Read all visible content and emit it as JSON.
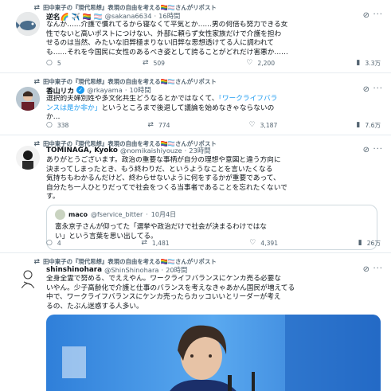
{
  "tweets": [
    {
      "retweeted_by": "田中東子の『現代思想』表現の自由を考える🏳️‍🌈🏳️‍⚧️さんがリポスト",
      "name": "逆名🌈 ✈️ 🏳️‍🌈 🏳️‍⚧️",
      "handle": "@sakana6634",
      "time": "16時間",
      "text": "なんか……介護で慣れてるから寝なくて平気とか……男の何倍も努力できる女\n性でないと高いポストにつけない、外部に頼らず女性家族だけで介護を担わ\nせるのは当然、みたいな旧弊極まりない旧弊な思想透けてる人に調われて\nも……それを今国民に女性のあるべき姿として誇ることがどれだけ害悪か……",
      "replies": "5",
      "retweets": "509",
      "likes": "2,200",
      "views": "3.3万"
    },
    {
      "retweeted_by": "田中東子の『現代思想』表現の自由を考える🏳️‍🌈🏳️‍⚧️さんがリポスト",
      "name": "香山リカ",
      "handle": "@rkayama",
      "time": "10時間",
      "text_plain": "選択的夫婦別姓や多文化共生どうなるとかではなくて、",
      "text_quote": "「ワークライフバラ\nンスは是か非か」",
      "text_tail": "というところまで後退して議論を始めなきゃならないの\nか…",
      "replies": "338",
      "retweets": "774",
      "likes": "3,187",
      "views": "7.6万"
    },
    {
      "retweeted_by": "田中東子の『現代思想』表現の自由を考える🏳️‍🌈🏳️‍⚧️さんがリポスト",
      "name": "TOMINAGA, Kyoko",
      "handle": "@nomikaishiyouze",
      "time": "23時間",
      "text": "ありがとうございます。政治の重要な事柄が自分の理想や意図と違う方向に\n決まってしまったとき、もう終わりだ、というようなことを言いたくなる\n気持ちもわかるんだけど、終わらせないように何をするかが重要であって、\n自分たち一人ひとりだってで社会をつくる当事者であることを忘れたくないで\nす。",
      "quote": {
        "name": "maco",
        "handle": "@fservice_bitter",
        "time": "10月4日",
        "text": "富永京子さんが仰ってた「選挙や政治だけで社会が決まるわけではな\nい」という言葉を思い出してる。"
      },
      "replies": "4",
      "retweets": "1,481",
      "likes": "4,391",
      "views": "26万"
    },
    {
      "retweeted_by": "田中東子の『現代思想』表現の自由を考える🏳️‍🌈🏳️‍⚧️さんがリポスト",
      "name": "shinshinohara",
      "handle": "@ShinShinohara",
      "time": "20時間",
      "text": "全身全霊で努める、でええやん。ワークライフバランスにケンカ売る必要な\nいやん。少子高齢化で介護と仕事のバランスを考えなきゃあかん国民が増えてる\n中で、ワークライフバランスにケンカ売ったらカッコいいとリーダーが考え\nるの、たぶん迷惑する人多い。"
    }
  ],
  "icons": {
    "retweet": "⇄",
    "reply": "○",
    "like": "♡",
    "views": "▮",
    "more": "···",
    "grok": "⊘"
  },
  "colors": {
    "accent": "#1d9bf0",
    "quote_highlight": "#1d9bf0",
    "muted": "#536471"
  }
}
